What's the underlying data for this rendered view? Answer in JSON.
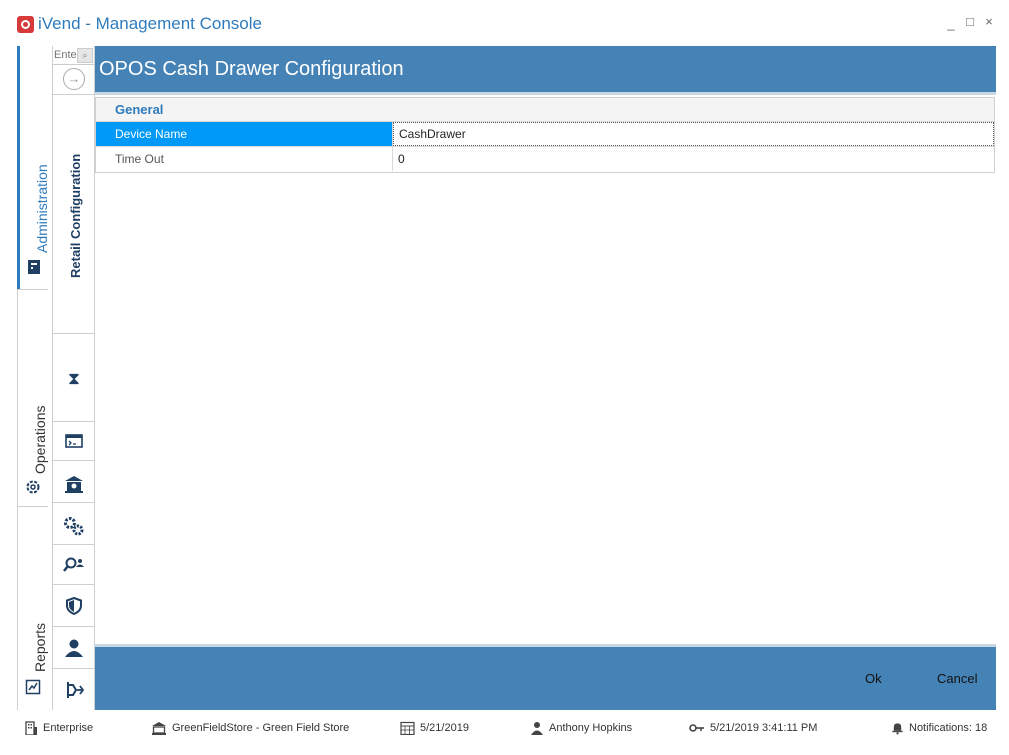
{
  "app": {
    "title": "iVend - Management Console",
    "window_controls": {
      "minimize": "_",
      "maximize": "□",
      "close": "×"
    }
  },
  "left_nav": {
    "items": [
      {
        "label": "Administration",
        "icon": "administration-icon",
        "active": true
      },
      {
        "label": "Operations",
        "icon": "gear-icon",
        "active": false
      },
      {
        "label": "Reports",
        "icon": "reports-icon",
        "active": false
      }
    ],
    "accent_color": "#2e7bbd"
  },
  "sub_nav": {
    "search_placeholder": "Enter",
    "search_icon": "search-icon",
    "back_icon": "arrow-right-circle-icon",
    "section_label": "Retail Configuration",
    "icons": [
      "hourglass-icon",
      "terminal-window-icon",
      "store-bank-icon",
      "gears-icon",
      "user-search-icon",
      "shield-icon",
      "person-icon",
      "integration-icon"
    ]
  },
  "main": {
    "title": "OPOS Cash Drawer Configuration",
    "header_color": "#4583b7",
    "property_grid": {
      "category": "General",
      "rows": [
        {
          "name": "Device Name",
          "value": "CashDrawer",
          "selected": true
        },
        {
          "name": "Time Out",
          "value": "0",
          "selected": false
        }
      ]
    },
    "footer": {
      "ok_label": "Ok",
      "cancel_label": "Cancel"
    }
  },
  "status_bar": {
    "company": "Enterprise",
    "store": "GreenFieldStore - Green Field Store",
    "date": "5/21/2019",
    "user": "Anthony Hopkins",
    "login_time": "5/21/2019 3:41:11 PM",
    "notifications": "Notifications: 18"
  }
}
